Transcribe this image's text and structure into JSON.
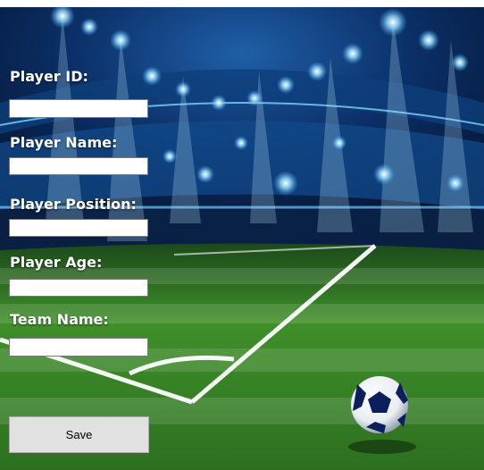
{
  "form": {
    "player_id_label": "Player ID:",
    "player_id_value": "",
    "player_name_label": "Player Name:",
    "player_name_value": "",
    "player_position_label": "Player Position:",
    "player_position_value": "",
    "player_age_label": "Player Age:",
    "player_age_value": "",
    "team_name_label": "Team Name:",
    "team_name_value": "",
    "save_label": "Save"
  },
  "background": {
    "image": "football-stadium-night",
    "colors": {
      "sky": "#0a2a5c",
      "lights": "#7fd4ff",
      "grass": "#3f8f2a",
      "field_lines": "#ffffff"
    }
  }
}
